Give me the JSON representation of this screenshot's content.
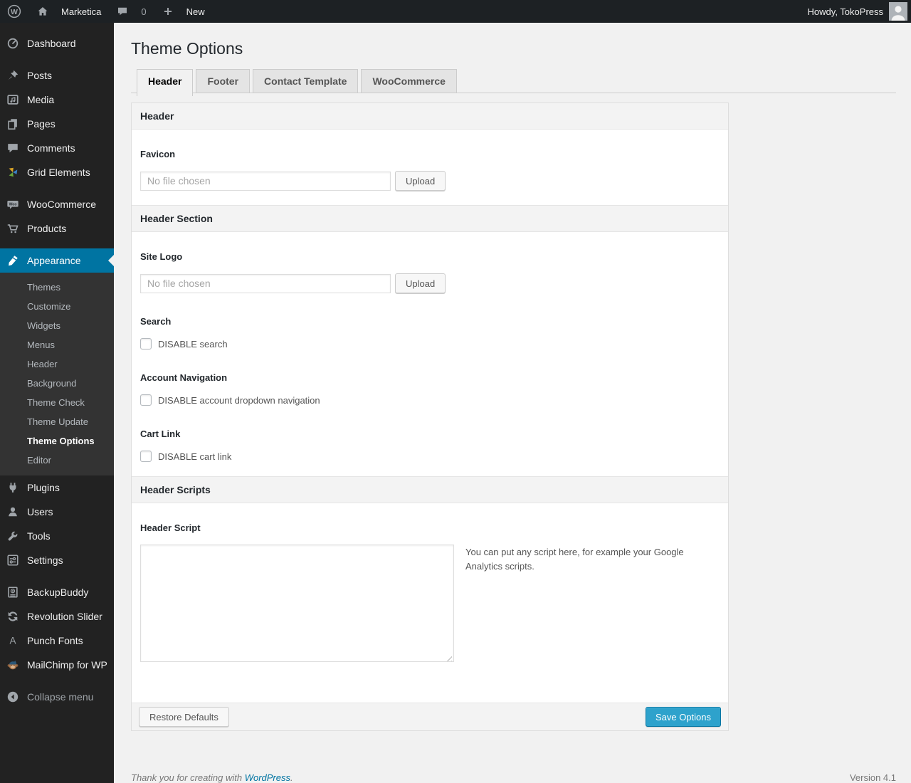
{
  "admin_bar": {
    "site_name": "Marketica",
    "comment_count": "0",
    "new_label": "New",
    "howdy_text": "Howdy, TokoPress"
  },
  "icon_glyphs": {
    "wp_logo": "W",
    "woo": "Woo",
    "punch_fonts": "A"
  },
  "sidebar": {
    "items": [
      {
        "label": "Dashboard",
        "icon": "dashboard-icon"
      },
      {
        "label": "Posts",
        "icon": "pushpin-icon"
      },
      {
        "label": "Media",
        "icon": "media-icon"
      },
      {
        "label": "Pages",
        "icon": "pages-icon"
      },
      {
        "label": "Comments",
        "icon": "comment-icon"
      },
      {
        "label": "Grid Elements",
        "icon": "grid-elements-icon"
      },
      {
        "label": "WooCommerce",
        "icon": "woocommerce-badge-icon"
      },
      {
        "label": "Products",
        "icon": "cart-icon"
      },
      {
        "label": "Appearance",
        "icon": "brush-icon",
        "active": true
      },
      {
        "label": "Plugins",
        "icon": "plug-icon"
      },
      {
        "label": "Users",
        "icon": "user-icon"
      },
      {
        "label": "Tools",
        "icon": "wrench-icon"
      },
      {
        "label": "Settings",
        "icon": "sliders-icon"
      },
      {
        "label": "BackupBuddy",
        "icon": "backup-drive-icon"
      },
      {
        "label": "Revolution Slider",
        "icon": "refresh-arrows-icon"
      },
      {
        "label": "Punch Fonts",
        "icon": "letter-a-icon"
      },
      {
        "label": "MailChimp for WP",
        "icon": "monkey-icon"
      },
      {
        "label": "Collapse menu",
        "icon": "collapse-arrow-icon"
      }
    ],
    "appearance_submenu": [
      "Themes",
      "Customize",
      "Widgets",
      "Menus",
      "Header",
      "Background",
      "Theme Check",
      "Theme Update",
      "Theme Options",
      "Editor"
    ],
    "current_submenu_item": "Theme Options"
  },
  "page": {
    "title": "Theme Options",
    "tabs": [
      {
        "label": "Header",
        "active": true
      },
      {
        "label": "Footer",
        "active": false
      },
      {
        "label": "Contact Template",
        "active": false
      },
      {
        "label": "WooCommerce",
        "active": false
      }
    ]
  },
  "panel": {
    "sections": {
      "header": "Header",
      "header_section": "Header Section",
      "header_scripts": "Header Scripts"
    },
    "fields": {
      "favicon": {
        "label": "Favicon",
        "placeholder": "No file chosen",
        "button": "Upload"
      },
      "site_logo": {
        "label": "Site Logo",
        "placeholder": "No file chosen",
        "button": "Upload"
      },
      "search": {
        "label": "Search",
        "checkbox_label": "DISABLE search",
        "checked": false
      },
      "account_navigation": {
        "label": "Account Navigation",
        "checkbox_label": "DISABLE account dropdown navigation",
        "checked": false
      },
      "cart_link": {
        "label": "Cart Link",
        "checkbox_label": "DISABLE cart link",
        "checked": false
      },
      "header_script": {
        "label": "Header Script",
        "value": "",
        "help_text": "You can put any script here, for example your Google Analytics scripts."
      }
    },
    "actions": {
      "restore": "Restore Defaults",
      "save": "Save Options"
    }
  },
  "footer": {
    "thanks_text": "Thank you for creating with ",
    "wordpress_link": "WordPress",
    "suffix": ".",
    "version": "Version 4.1"
  },
  "colors": {
    "adminbar_bg": "#1d2124",
    "menu_bg": "#222222",
    "submenu_bg": "#333333",
    "menu_highlight": "#0074a2",
    "primary_button": "#2ea2cc",
    "page_bg": "#f1f1f1",
    "link_blue": "#0074a2"
  }
}
